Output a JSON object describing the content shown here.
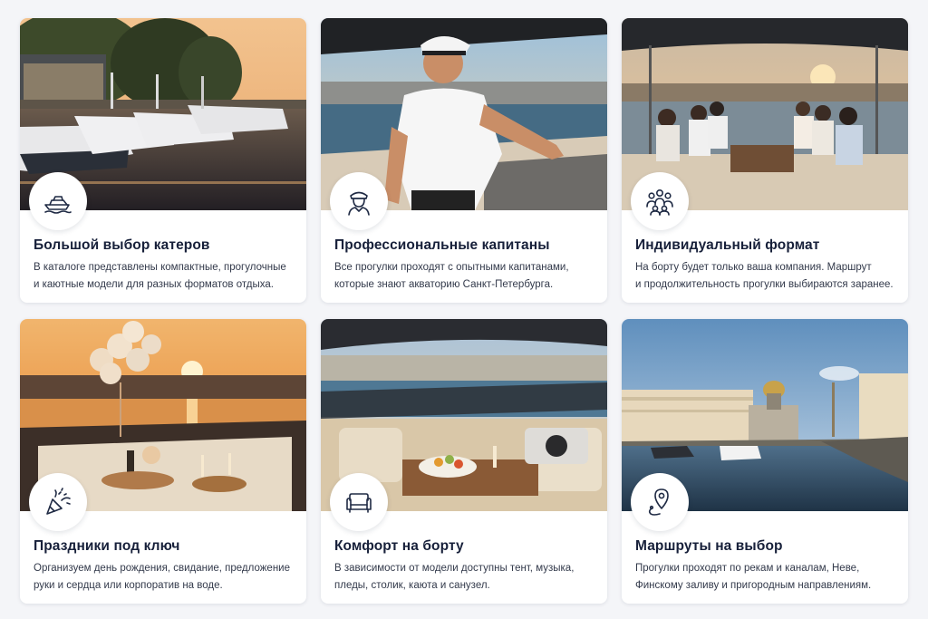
{
  "cards": [
    {
      "icon": "yacht-icon",
      "title": "Большой выбор катеров",
      "line1": "В каталоге представлены компактные, прогулочные",
      "line2": "и каютные модели для разных форматов отдыха."
    },
    {
      "icon": "captain-icon",
      "title": "Профессиональные капитаны",
      "line1": "Все прогулки проходят с опытными капитанами,",
      "line2": "которые знают акваторию Санкт-Петербурга."
    },
    {
      "icon": "people-group-icon",
      "title": "Индивидуальный формат",
      "line1": "На борту будет только ваша компания. Маршрут",
      "line2": "и продолжительность прогулки выбираются заранее."
    },
    {
      "icon": "party-popper-icon",
      "title": "Праздники под ключ",
      "line1": "Организуем день рождения, свидание, предложение",
      "line2": "руки и сердца или корпоратив на воде."
    },
    {
      "icon": "sofa-icon",
      "title": "Комфорт на борту",
      "line1": "В зависимости от модели доступны тент, музыка,",
      "line2": "пледы, столик, каюта и санузел."
    },
    {
      "icon": "map-pin-route-icon",
      "title": "Маршруты на выбор",
      "line1": "Прогулки проходят по рекам и каналам, Неве,",
      "line2": "Финскому заливу и пригородным направлениям."
    }
  ],
  "colors": {
    "page_bg": "#f4f5f8",
    "card_bg": "#ffffff",
    "title": "#17203a",
    "text": "#333a4b",
    "icon_stroke": "#1f2a44"
  }
}
